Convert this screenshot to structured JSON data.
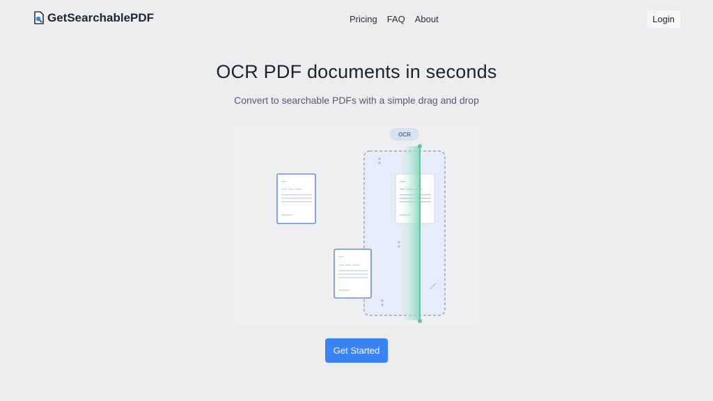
{
  "header": {
    "brand": "GetSearchablePDF",
    "nav": [
      {
        "label": "Pricing"
      },
      {
        "label": "FAQ"
      },
      {
        "label": "About"
      }
    ],
    "login_label": "Login"
  },
  "hero": {
    "title": "OCR PDF documents in seconds",
    "subtitle": "Convert to searchable PDFs with a simple drag and drop"
  },
  "illustration": {
    "badge": "OCR"
  },
  "cta": {
    "label": "Get Started"
  },
  "colors": {
    "background": "#ecedee",
    "accent": "#3b82f6",
    "scan_line": "#5cc7a0",
    "document_border": "#6b8fd6"
  }
}
